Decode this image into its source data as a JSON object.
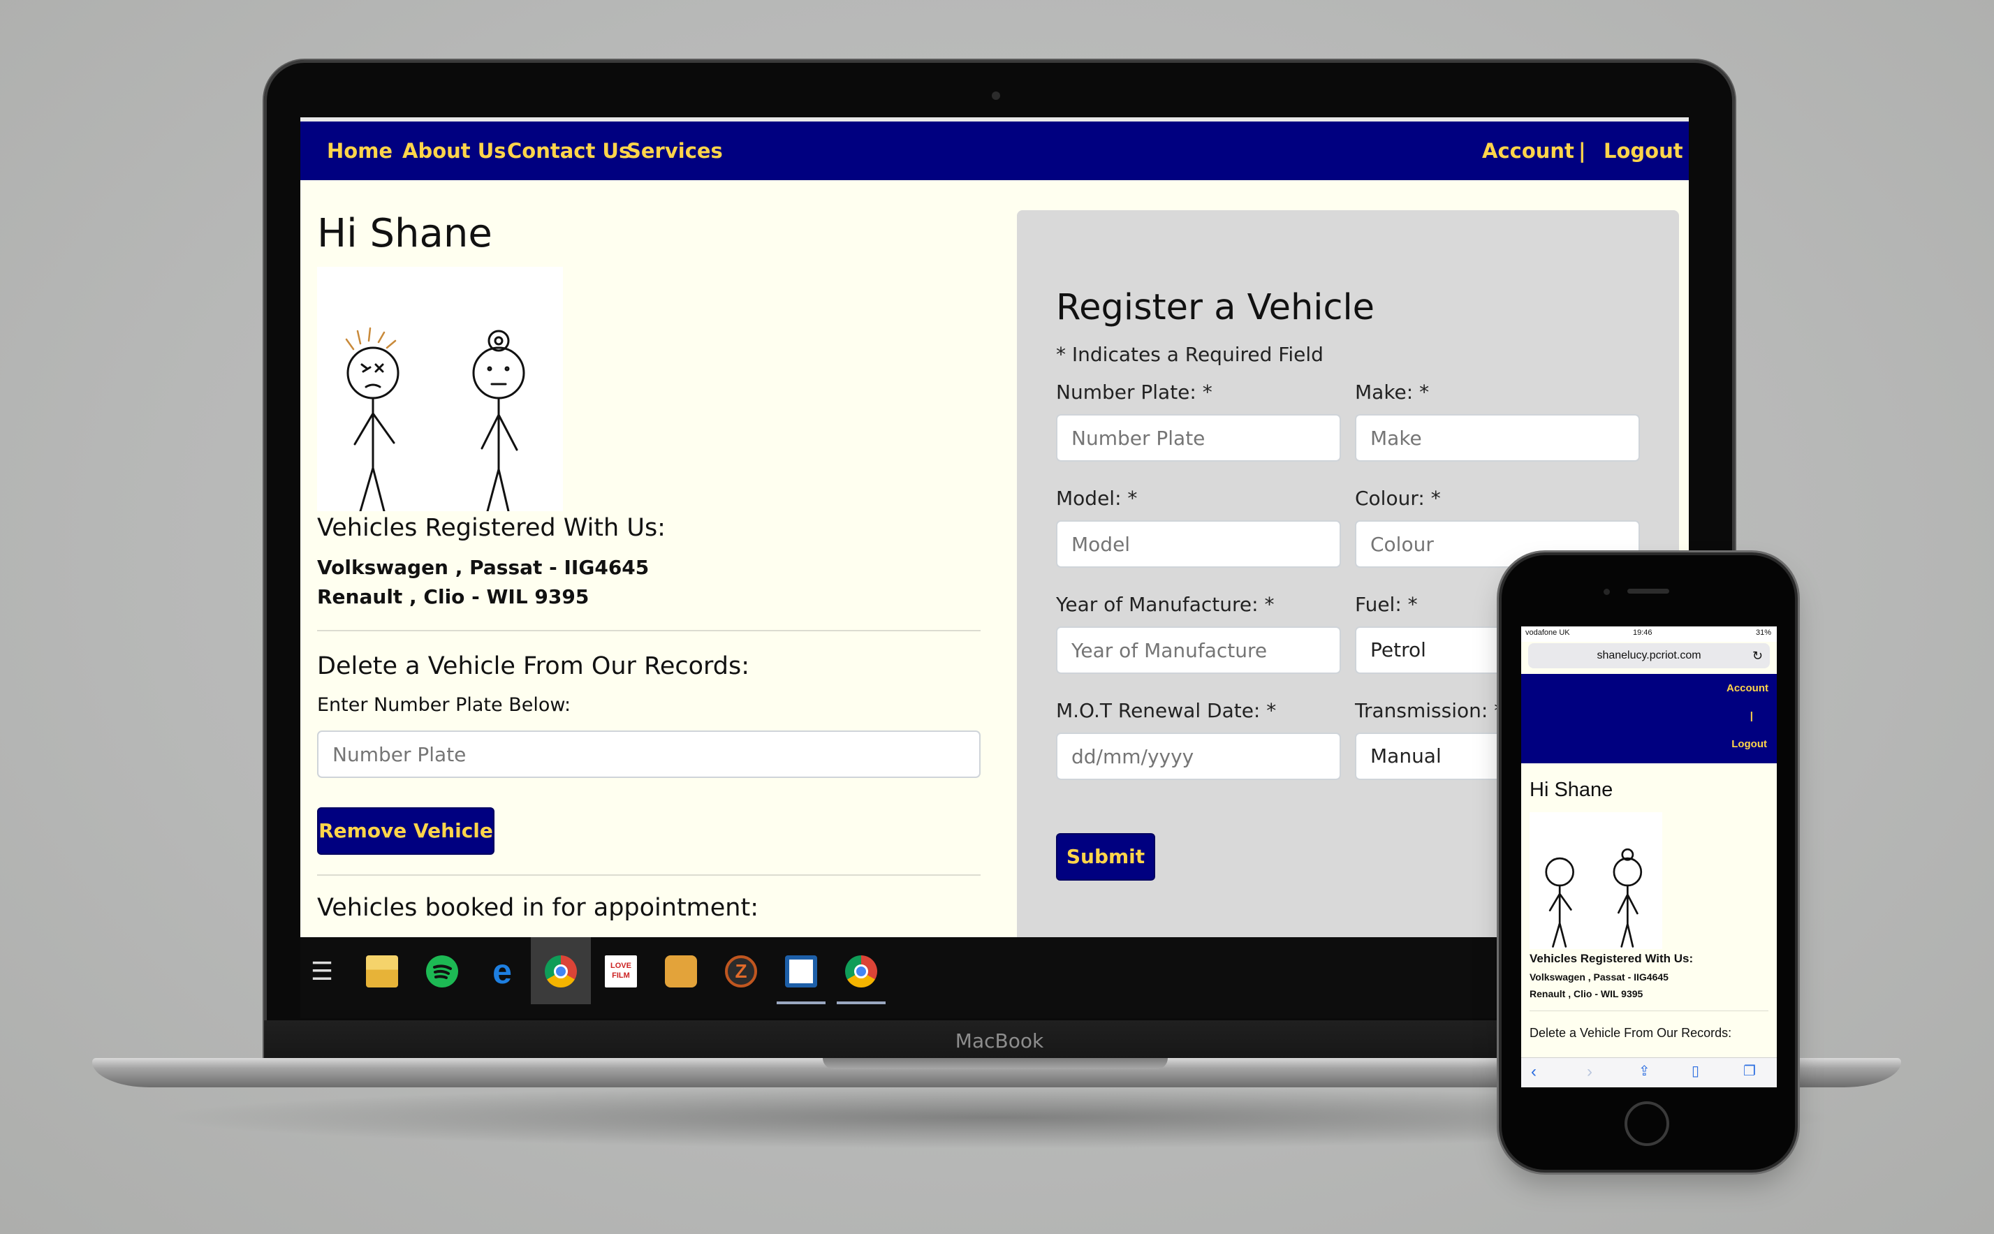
{
  "laptop": {
    "brand_label": "MacBook",
    "nav": {
      "links": [
        "Home",
        "About Us",
        "Contact Us",
        "Services"
      ],
      "account": "Account",
      "separator": "|",
      "logout": "Logout"
    },
    "greeting": "Hi Shane",
    "registered_heading": "Vehicles Registered With Us:",
    "vehicles": [
      "Volkswagen , Passat - IIG4645",
      "Renault , Clio - WIL 9395"
    ],
    "delete_heading": "Delete a Vehicle From Our Records:",
    "delete_label": "Enter Number Plate Below:",
    "delete_placeholder": "Number Plate",
    "remove_button": "Remove Vehicle",
    "booked_heading": "Vehicles booked in for appointment:",
    "form": {
      "title": "Register a Vehicle",
      "required_note": "* Indicates a Required Field",
      "number_plate_label": "Number Plate: *",
      "number_plate_placeholder": "Number Plate",
      "make_label": "Make: *",
      "make_placeholder": "Make",
      "model_label": "Model: *",
      "model_placeholder": "Model",
      "colour_label": "Colour: *",
      "colour_placeholder": "Colour",
      "year_label": "Year of Manufacture: *",
      "year_placeholder": "Year of Manufacture",
      "fuel_label": "Fuel: *",
      "fuel_value": "Petrol",
      "mot_label": "M.O.T Renewal Date: *",
      "mot_placeholder": "dd/mm/yyyy",
      "transmission_label": "Transmission: *",
      "transmission_value": "Manual",
      "submit": "Submit"
    },
    "taskbar_icons": [
      "task-view-icon",
      "file-explorer-icon",
      "spotify-icon",
      "edge-icon",
      "chrome-icon",
      "lovefilm-icon",
      "notes-icon",
      "filezilla-icon",
      "app-icon",
      "chrome-icon"
    ]
  },
  "phone": {
    "status_carrier": "vodafone UK",
    "status_time": "19:46",
    "status_battery": "31%",
    "url": "shanelucy.pcriot.com",
    "nav_account": "Account",
    "nav_separator": "|",
    "nav_logout": "Logout",
    "greeting": "Hi Shane",
    "registered_heading": "Vehicles Registered With Us:",
    "vehicles": [
      "Volkswagen , Passat - IIG4645",
      "Renault , Clio - WIL 9395"
    ],
    "delete_heading": "Delete a Vehicle From Our Records:"
  },
  "colors": {
    "nav_bg": "#000080",
    "nav_text": "#ffd54a",
    "page_bg": "#fffff0",
    "form_bg": "#d9d9d9"
  }
}
